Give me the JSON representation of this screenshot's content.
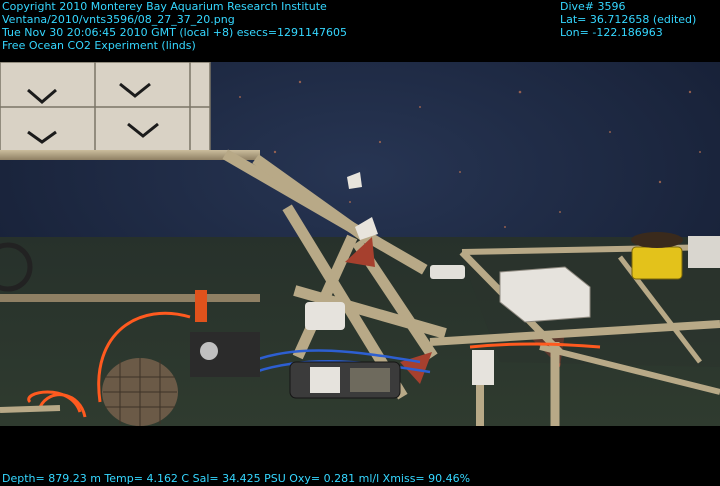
{
  "overlay": {
    "top_left": [
      "Copyright 2010 Monterey Bay Aquarium Research Institute",
      "Ventana/2010/vnts3596/08_27_37_20.png",
      "Tue Nov 30 20:06:45 2010 GMT (local +8)  esecs=1291147605",
      "Free Ocean CO2 Experiment (linds)"
    ],
    "top_right": [
      "Dive# 3596",
      "Lat= 36.712658 (edited)",
      "Lon= -122.186963"
    ],
    "bottom": "Depth= 879.23 m  Temp= 4.162 C  Sal= 34.425 PSU  Oxy= 0.281 ml/l  Xmiss= 90.46%"
  },
  "colors": {
    "overlay_text": "#35d7ff",
    "water": "#1e2a45",
    "frame_tan": "#b9a98a",
    "frame_red": "#a6402e",
    "yellow_sensor": "#e3c21b",
    "orange_cable": "#ff5a1f"
  }
}
